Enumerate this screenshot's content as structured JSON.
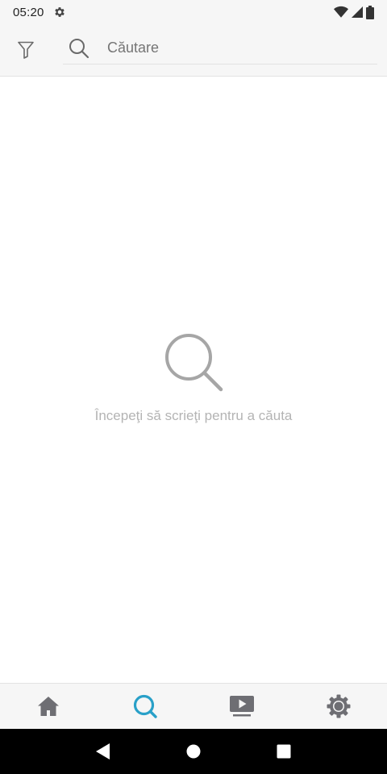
{
  "status_bar": {
    "time": "05:20",
    "icons": [
      "gear-icon",
      "wifi-icon",
      "cell-signal-icon",
      "battery-icon"
    ]
  },
  "header": {
    "filter_icon": "filter-icon",
    "search_icon": "search-icon",
    "search_placeholder": "Căutare",
    "search_value": ""
  },
  "empty_state": {
    "icon": "search-icon",
    "message": "Începeţi să scrieţi pentru a căuta"
  },
  "bottom_nav": {
    "items": [
      {
        "icon": "home-icon",
        "active": false
      },
      {
        "icon": "search-icon",
        "active": true
      },
      {
        "icon": "video-icon",
        "active": false
      },
      {
        "icon": "settings-icon",
        "active": false
      }
    ],
    "active_color": "#29a0c8",
    "inactive_color": "#6e6e73"
  },
  "system_nav": {
    "buttons": [
      "back-icon",
      "home-circle-icon",
      "recents-icon"
    ]
  }
}
